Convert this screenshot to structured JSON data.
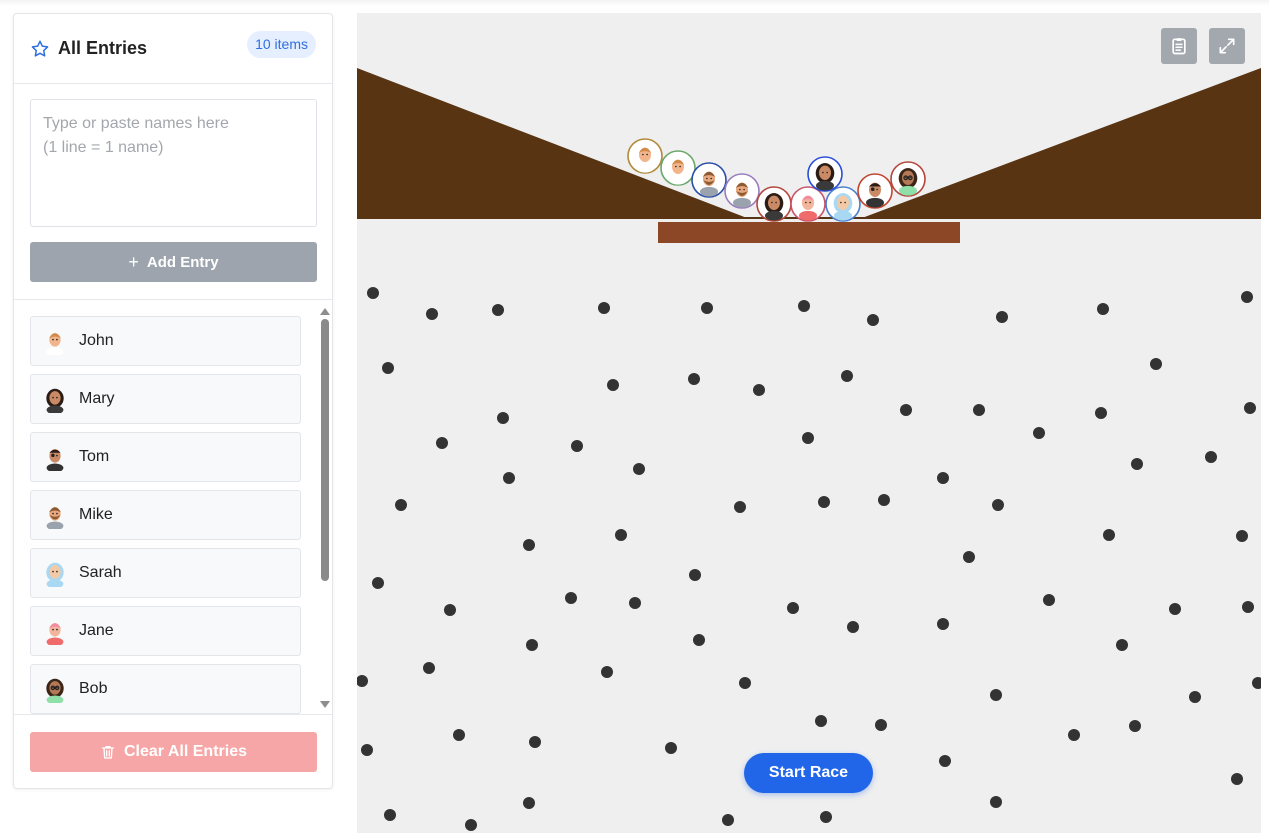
{
  "sidebar": {
    "title": "All Entries",
    "badge": "10 items",
    "input_placeholder": "Type or paste names here\n(1 line = 1 name)",
    "add_label": "Add Entry",
    "clear_label": "Clear All Entries",
    "entries": [
      {
        "name": "John",
        "avatar": "man-short-hair-avatar"
      },
      {
        "name": "Mary",
        "avatar": "woman-long-dark-hair-avatar"
      },
      {
        "name": "Tom",
        "avatar": "man-eyepatch-avatar"
      },
      {
        "name": "Mike",
        "avatar": "man-beard-avatar"
      },
      {
        "name": "Sarah",
        "avatar": "woman-hijab-avatar"
      },
      {
        "name": "Jane",
        "avatar": "woman-pink-hair-avatar"
      },
      {
        "name": "Bob",
        "avatar": "person-curly-hair-glasses-avatar"
      }
    ]
  },
  "stage": {
    "start_label": "Start Race",
    "ground_color": "#583413",
    "gate_color": "#8b4726",
    "peg_color": "#333333",
    "background_color": "#efefef",
    "toolbar_icons": [
      "clipboard-icon",
      "expand-icon"
    ]
  },
  "colors": {
    "accent": "#2166e8",
    "badge_text": "#2f6fe0",
    "button_gray": "#9ea4ad",
    "danger_light": "#f6a6a6"
  }
}
